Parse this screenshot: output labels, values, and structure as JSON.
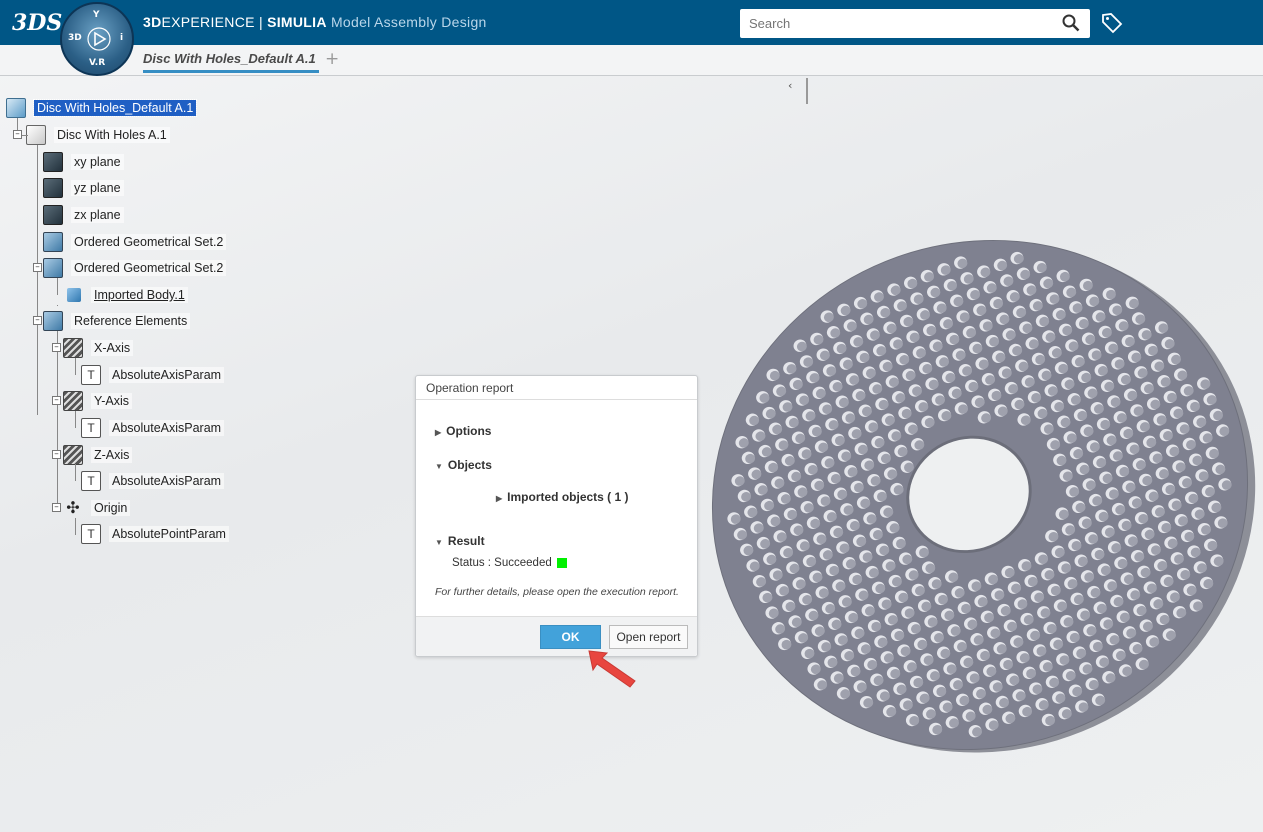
{
  "header": {
    "brand_bold": "3D",
    "brand": "EXPERIENCE",
    "separator": " | ",
    "product": "SIMULIA",
    "app": "Model Assembly Design",
    "compass": {
      "top": "Y",
      "left": "3D",
      "right": "i",
      "bottom": "V.R"
    },
    "search_placeholder": "Search"
  },
  "tabs": {
    "active": "Disc With Holes_Default A.1",
    "add": "+"
  },
  "panel": {
    "collapse": "‹"
  },
  "tree": [
    {
      "label": "Disc With Holes_Default A.1",
      "icon": "product-icon",
      "type": "prod",
      "level": 0,
      "selected": true
    },
    {
      "label": "Disc With Holes A.1",
      "icon": "part-icon",
      "type": "part",
      "level": 1
    },
    {
      "label": "xy plane",
      "icon": "plane-icon",
      "type": "plane",
      "level": 2
    },
    {
      "label": "yz plane",
      "icon": "plane-icon",
      "type": "plane",
      "level": 2
    },
    {
      "label": "zx plane",
      "icon": "plane-icon",
      "type": "plane",
      "level": 2
    },
    {
      "label": "Ordered Geometrical Set.2",
      "icon": "geometrical-set-icon",
      "type": "ogs",
      "level": 2
    },
    {
      "label": "Ordered Geometrical Set.2",
      "icon": "geometrical-set-icon",
      "type": "ogs",
      "level": 2
    },
    {
      "label": "Imported Body.1",
      "icon": "body-icon",
      "type": "body",
      "level": 3,
      "underline": true
    },
    {
      "label": "Reference Elements",
      "icon": "geometrical-set-icon",
      "type": "ogs",
      "level": 2
    },
    {
      "label": "X-Axis",
      "icon": "axis-icon",
      "type": "axis",
      "level": 3
    },
    {
      "label": "AbsoluteAxisParam",
      "icon": "parameter-icon",
      "type": "param",
      "level": 4
    },
    {
      "label": "Y-Axis",
      "icon": "axis-icon",
      "type": "axis",
      "level": 3
    },
    {
      "label": "AbsoluteAxisParam",
      "icon": "parameter-icon",
      "type": "param",
      "level": 4
    },
    {
      "label": "Z-Axis",
      "icon": "axis-icon",
      "type": "axis",
      "level": 3
    },
    {
      "label": "AbsoluteAxisParam",
      "icon": "parameter-icon",
      "type": "param",
      "level": 4
    },
    {
      "label": "Origin",
      "icon": "origin-icon",
      "type": "origin",
      "level": 3
    },
    {
      "label": "AbsolutePointParam",
      "icon": "parameter-icon",
      "type": "param",
      "level": 4
    }
  ],
  "dialog": {
    "title": "Operation report",
    "options": "Options",
    "objects": "Objects",
    "imported": "Imported objects ( 1 )",
    "result": "Result",
    "status": "Status : Succeeded",
    "status_color": "#00f000",
    "note": "For further details, please open the execution report.",
    "ok": "OK",
    "open_report": "Open report"
  },
  "colors": {
    "header": "#005686",
    "accent": "#42a2da",
    "selection": "#1f5fc4",
    "annotation_arrow": "#e8463f"
  }
}
